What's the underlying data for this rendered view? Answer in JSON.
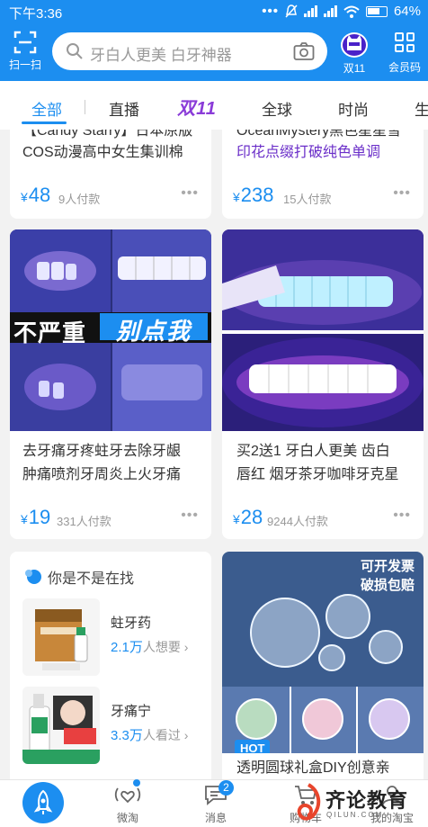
{
  "status": {
    "time": "下午3:36",
    "battery": "64%"
  },
  "header": {
    "scan_label": "扫一扫",
    "search_placeholder": "牙白人更美 白牙神器",
    "double11_label": "双11",
    "member_label": "会员码"
  },
  "tabs": {
    "items": [
      "全部",
      "直播",
      "全球",
      "时尚",
      "生"
    ],
    "promo": "双11",
    "active": "全部"
  },
  "products": [
    {
      "title_lines": [
        "【Candy Starry】日本原版",
        "COS动漫高中女生集训棉"
      ],
      "price": "48",
      "sold": "9人付款"
    },
    {
      "title_lines": [
        "OceanMystery黑色星星雪",
        "印花点缀打破纯色单调"
      ],
      "price": "238",
      "sold": "15人付款"
    },
    {
      "title_lines": [
        "去牙痛牙疼蛀牙去除牙龈",
        "肿痛喷剂牙周炎上火牙痛"
      ],
      "price": "19",
      "sold": "331人付款",
      "overlay": {
        "part1": "不严重",
        "part2": "别点我"
      }
    },
    {
      "title_lines": [
        "买2送1 牙白人更美 齿白",
        "唇红 烟牙茶牙咖啡牙克星"
      ],
      "price": "28",
      "sold": "9244人付款"
    },
    {
      "title_lines": [
        "透明圆球礼盒DIY创意亲"
      ],
      "overlay": {
        "line1": "可开发票",
        "line2": "破损包赔"
      },
      "hot": "HOT"
    }
  ],
  "currency": "¥",
  "find": {
    "header": "你是不是在找",
    "items": [
      {
        "name": "蛀牙药",
        "count": "2.1万",
        "suffix": "人想要 ›"
      },
      {
        "name": "牙痛宁",
        "count": "3.3万",
        "suffix": "人看过 ›"
      }
    ]
  },
  "bottom_nav": {
    "items": [
      "微淘",
      "消息",
      "购物车",
      "我的淘宝"
    ],
    "message_badge": "2"
  },
  "watermark": {
    "text": "齐论教育",
    "sub": "QILUN.COM"
  },
  "colors": {
    "brand": "#1c8ef0",
    "promo_purple": "#6b2fc9"
  }
}
